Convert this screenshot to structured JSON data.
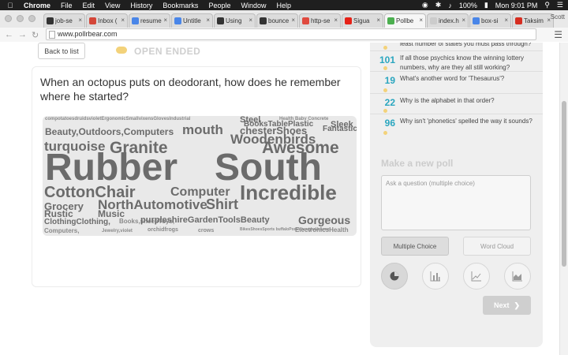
{
  "menubar": {
    "app": "Chrome",
    "items": [
      "File",
      "Edit",
      "View",
      "History",
      "Bookmarks",
      "People",
      "Window",
      "Help"
    ],
    "battery": "100%",
    "clock": "Mon 9:01 PM"
  },
  "tabs": [
    {
      "label": "job-se",
      "color": "#333333"
    },
    {
      "label": "Inbox (",
      "color": "#d44638"
    },
    {
      "label": "resume",
      "color": "#4a86e8"
    },
    {
      "label": "Untitle",
      "color": "#4a86e8"
    },
    {
      "label": "Using",
      "color": "#333333"
    },
    {
      "label": "bounce",
      "color": "#333333"
    },
    {
      "label": "http-se",
      "color": "#e04a3f"
    },
    {
      "label": "Sigua",
      "color": "#e62117"
    },
    {
      "label": "Pollbe",
      "color": "#4caf50"
    },
    {
      "label": "index.h",
      "color": "#cccccc"
    },
    {
      "label": "box-si",
      "color": "#4a86e8"
    },
    {
      "label": "Taksim",
      "color": "#d62d20"
    }
  ],
  "profile": "Scott",
  "url": "www.pollrbear.com",
  "back_label": "Back to list",
  "open_ended": "OPEN ENDED",
  "question": "When an octopus puts on deodorant, how does he remember where he started?",
  "cloud_words": [
    {
      "t": "compotatoesdruidsvioletErgonomicSmallvixensGlovesIndustrial",
      "s": 6
    },
    {
      "t": "Steel",
      "s": 11
    },
    {
      "t": "Health Baby Concrete",
      "s": 6
    },
    {
      "t": "BooksTablePlastic",
      "s": 10
    },
    {
      "t": "Sleek",
      "s": 11
    },
    {
      "t": "Beauty,Outdoors,Computers",
      "s": 12
    },
    {
      "t": "mouth",
      "s": 17
    },
    {
      "t": "chesterShoes",
      "s": 13
    },
    {
      "t": "Fantastic",
      "s": 10
    },
    {
      "t": "Woodenbirds",
      "s": 17
    },
    {
      "t": "turquoise",
      "s": 17
    },
    {
      "t": "Granite",
      "s": 21
    },
    {
      "t": "Awesome",
      "s": 21
    },
    {
      "t": "Rubber",
      "s": 48
    },
    {
      "t": "South",
      "s": 48
    },
    {
      "t": "CottonChair",
      "s": 20
    },
    {
      "t": "Computer",
      "s": 16
    },
    {
      "t": "Incredible",
      "s": 26
    },
    {
      "t": "Grocery",
      "s": 13
    },
    {
      "t": "NorthAutomotive",
      "s": 17
    },
    {
      "t": "Shirt",
      "s": 18
    },
    {
      "t": "Rustic",
      "s": 12
    },
    {
      "t": "Music",
      "s": 12
    },
    {
      "t": "ClothingClothing,",
      "s": 10
    },
    {
      "t": "Books,sheepToys,",
      "s": 8
    },
    {
      "t": "purpleshireGardenToolsBeauty",
      "s": 11
    },
    {
      "t": "Gorgeous",
      "s": 14
    },
    {
      "t": "Computers,",
      "s": 8
    },
    {
      "t": "Jewelry,violet",
      "s": 6
    },
    {
      "t": "orchidfrogs",
      "s": 7
    },
    {
      "t": "crows",
      "s": 7
    },
    {
      "t": "BikesShoesSports buffaloPosReboughsVolume",
      "s": 5
    },
    {
      "t": "ElectronicsHealth",
      "s": 8
    }
  ],
  "sidebar_polls": [
    {
      "count": "",
      "text": "least number of states you must pass through?"
    },
    {
      "count": "101",
      "text": "If all those psychics know the winning lottery numbers, why are they all still working?"
    },
    {
      "count": "19",
      "text": "What's another word for 'Thesaurus'?"
    },
    {
      "count": "22",
      "text": "Why is the alphabet in that order?"
    },
    {
      "count": "96",
      "text": "Why isn't 'phonetics' spelled the way it sounds?"
    }
  ],
  "make_poll": {
    "heading": "Make a new poll",
    "placeholder": "Ask a question (multiple choice)",
    "multiple_choice": "Multiple Choice",
    "word_cloud": "Word Cloud",
    "next": "Next"
  }
}
